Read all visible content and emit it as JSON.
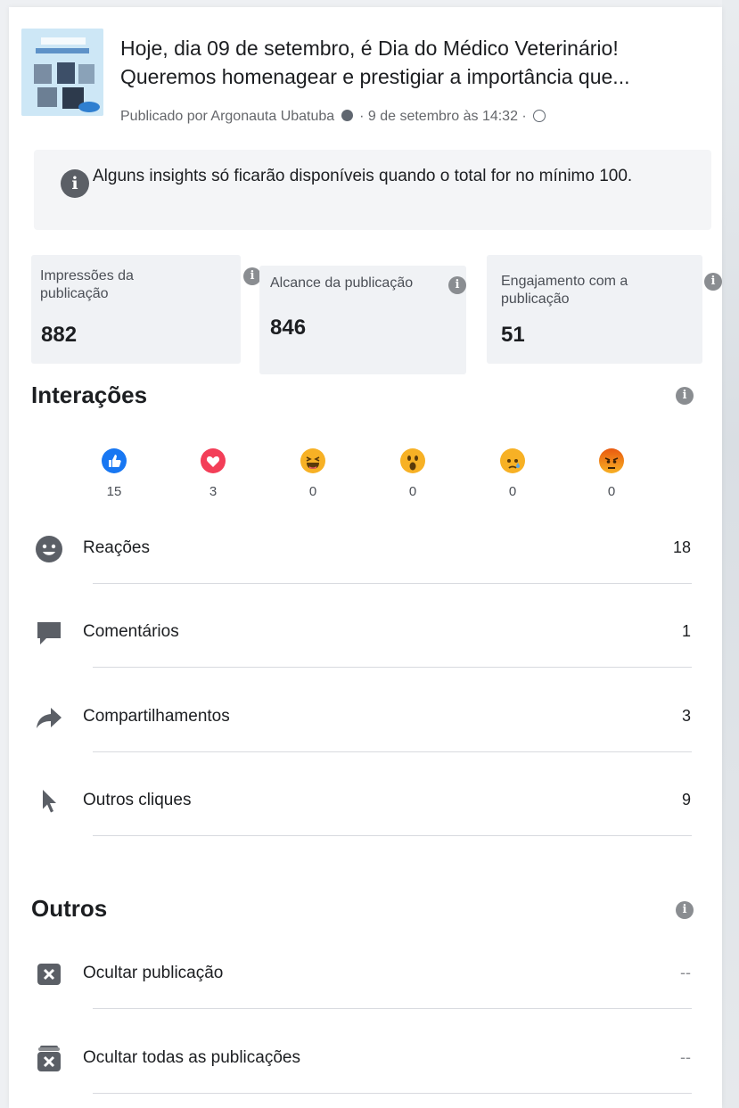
{
  "post": {
    "title_line1": "Hoje, dia 09 de setembro, é Dia do Médico Veterinário!",
    "title_line2": "Queremos homenagear e prestigiar a importância que...",
    "meta_author": "Publicado por Argonauta Ubatuba",
    "meta_date": "· 9 de setembro às 14:32 ·"
  },
  "notice": {
    "text": "Alguns insights só ficarão disponíveis quando o total for no mínimo 100."
  },
  "metrics": [
    {
      "label": "Impressões da publicação",
      "value": "882"
    },
    {
      "label": "Alcance da publicação",
      "value": "846"
    },
    {
      "label": "Engajamento com a publicação",
      "value": "51"
    }
  ],
  "interactions": {
    "title": "Interações",
    "reactions": [
      {
        "icon": "like-icon",
        "count": "15",
        "color": "#1877f2"
      },
      {
        "icon": "love-icon",
        "count": "3",
        "color": "#f33e58"
      },
      {
        "icon": "haha-icon",
        "count": "0",
        "color": "#f7b125"
      },
      {
        "icon": "wow-icon",
        "count": "0",
        "color": "#f7b125"
      },
      {
        "icon": "sad-icon",
        "count": "0",
        "color": "#f7b125"
      },
      {
        "icon": "angry-icon",
        "count": "0",
        "color": "#e9710f"
      }
    ],
    "rows": [
      {
        "icon": "smiley-icon",
        "label": "Reações",
        "value": "18"
      },
      {
        "icon": "comment-icon",
        "label": "Comentários",
        "value": "1"
      },
      {
        "icon": "share-icon",
        "label": "Compartilhamentos",
        "value": "3"
      },
      {
        "icon": "cursor-icon",
        "label": "Outros cliques",
        "value": "9"
      }
    ]
  },
  "others": {
    "title": "Outros",
    "rows": [
      {
        "icon": "hide-post-icon",
        "label": "Ocultar publicação",
        "value": "--"
      },
      {
        "icon": "hide-all-icon",
        "label": "Ocultar todas as publicações",
        "value": "--"
      }
    ]
  }
}
